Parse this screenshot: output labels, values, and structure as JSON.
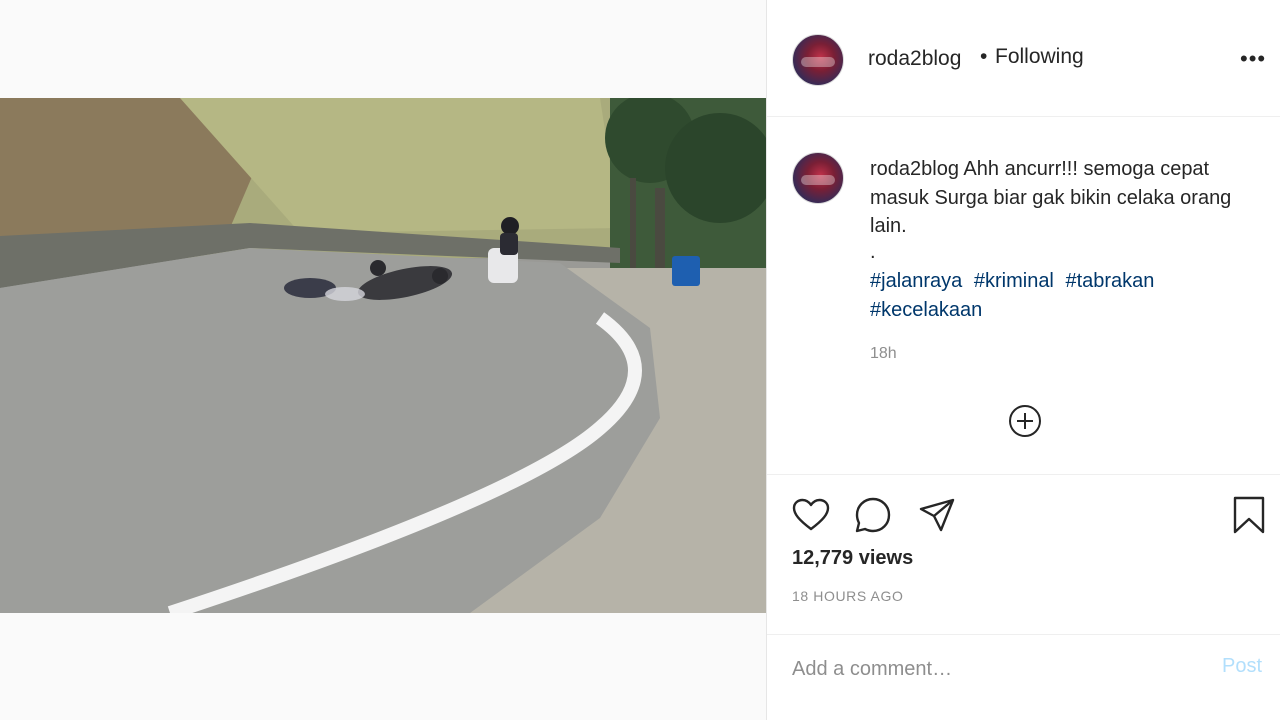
{
  "post": {
    "username": "roda2blog",
    "separator": "•",
    "follow_status": "Following",
    "more_icon": "more-horizontal-icon"
  },
  "caption": {
    "username": "roda2blog",
    "text": "Ahh ancurr!!! semoga cepat masuk Surga biar gak bikin celaka orang lain.",
    "dot": ".",
    "hashtags": [
      "#jalanraya",
      "#kriminal",
      "#tabrakan",
      "#kecelakaan"
    ],
    "time": "18h"
  },
  "actions": {
    "icons": [
      "heart-icon",
      "comment-icon",
      "share-icon",
      "bookmark-icon"
    ],
    "views": "12,779 views",
    "timestamp": "18 HOURS AGO"
  },
  "comment": {
    "placeholder": "Add a comment…",
    "post_label": "Post"
  },
  "colors": {
    "link": "#00376b",
    "muted": "#8e8e8e",
    "post_disabled": "#b2dffc"
  }
}
